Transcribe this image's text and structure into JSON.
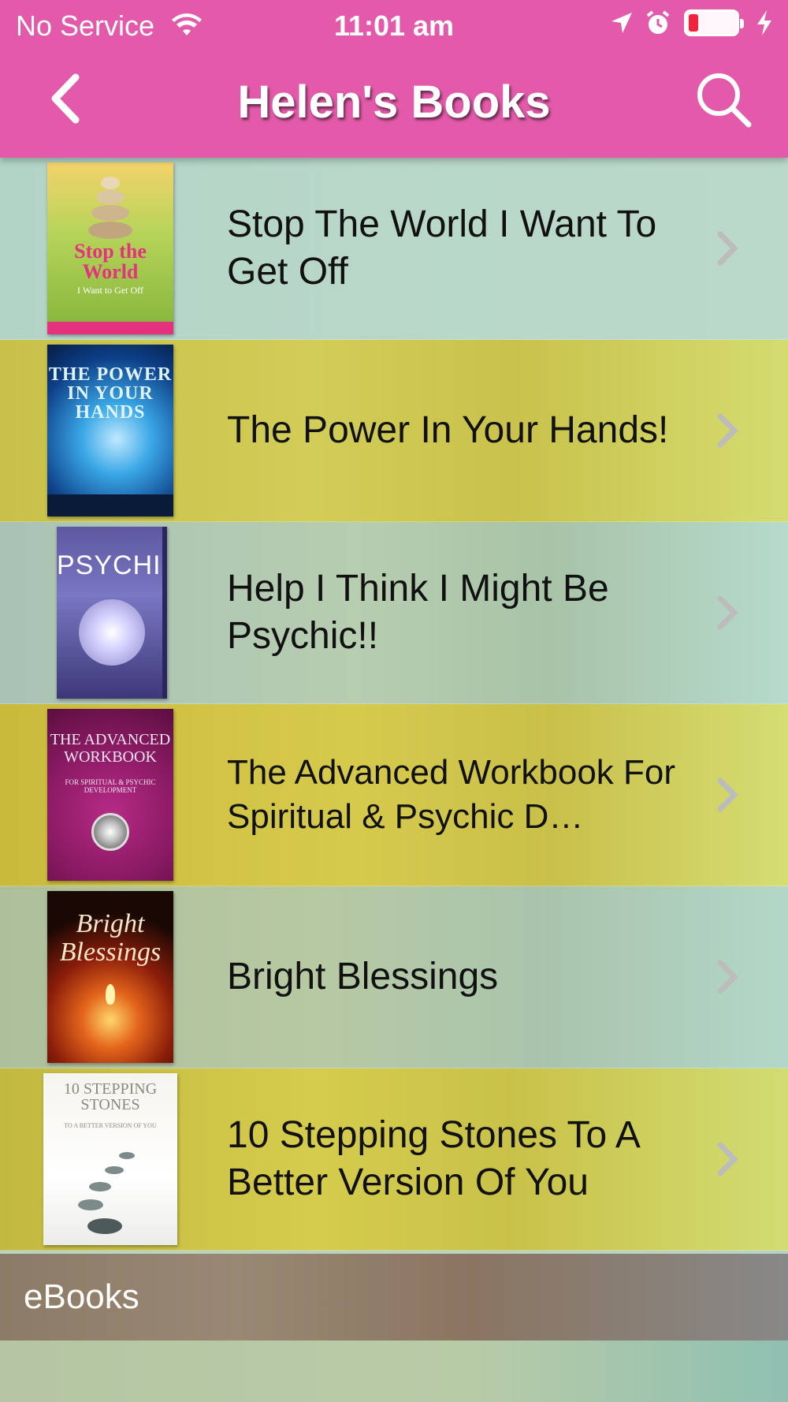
{
  "status_bar": {
    "carrier": "No Service",
    "time": "11:01 am"
  },
  "nav": {
    "title": "Helen's Books",
    "back_icon": "chevron-left-icon",
    "search_icon": "search-icon"
  },
  "colors": {
    "nav_background": "#e25aa9",
    "battery_low": "#f0233c"
  },
  "books": [
    {
      "title": "Stop The World I Want To Get Off",
      "cover_text": "Stop the World",
      "cover_subtext": "I Want to Get Off"
    },
    {
      "title": "The Power In Your Hands!",
      "cover_text": "THE POWER IN YOUR HANDS"
    },
    {
      "title": "Help I Think I Might Be Psychic!!",
      "cover_text": "PSYCHIC"
    },
    {
      "title": "The Advanced Workbook For Spiritual & Psychic D…",
      "cover_text": "THE ADVANCED WORKBOOK",
      "cover_subtext": "FOR SPIRITUAL & PSYCHIC DEVELOPMENT"
    },
    {
      "title": "Bright Blessings",
      "cover_text": "Bright Blessings"
    },
    {
      "title": "10 Stepping Stones To A Better Version Of You",
      "cover_text": "10 STEPPING STONES",
      "cover_subtext": "TO A BETTER VERSION OF YOU"
    }
  ],
  "section": {
    "label": "eBooks"
  }
}
